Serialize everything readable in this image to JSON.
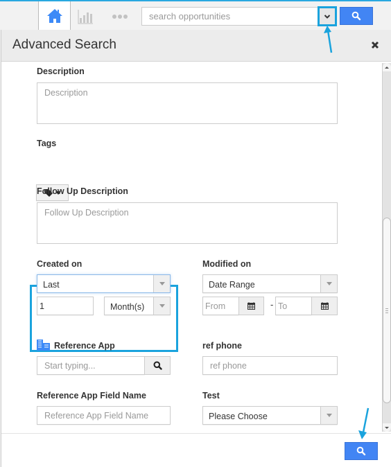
{
  "topbar": {
    "nav": [
      {
        "name": "home",
        "icon": "home-icon",
        "active": true
      },
      {
        "name": "reports",
        "icon": "bar-chart-icon",
        "active": false
      },
      {
        "name": "more",
        "icon": "more-dots-icon",
        "active": false
      }
    ],
    "search": {
      "placeholder": "search opportunities",
      "value": "",
      "dropdown_icon": "chevron-down-icon",
      "button_icon": "search-icon"
    }
  },
  "modal": {
    "title": "Advanced Search",
    "close_icon": "close-icon",
    "fields": {
      "description": {
        "label": "Description",
        "placeholder": "Description"
      },
      "tags": {
        "label": "Tags",
        "icon": "tag-icon"
      },
      "follow_up_description": {
        "label": "Follow Up Description",
        "placeholder": "Follow Up Description"
      },
      "created_on": {
        "label": "Created on",
        "mode": "Last",
        "amount": "1",
        "unit": "Month(s)"
      },
      "modified_on": {
        "label": "Modified on",
        "mode": "Date Range",
        "from_placeholder": "From",
        "to_placeholder": "To",
        "separator": "-"
      },
      "reference_app": {
        "label": "Reference App",
        "placeholder": "Start typing...",
        "icon": "building-icon"
      },
      "ref_phone": {
        "label": "ref phone",
        "placeholder": "ref phone"
      },
      "reference_app_field_name": {
        "label": "Reference App Field Name",
        "placeholder": "Reference App Field Name"
      },
      "test": {
        "label": "Test",
        "value": "Please Choose"
      }
    },
    "footer": {
      "search_icon": "search-icon"
    }
  },
  "colors": {
    "accent": "#4285f4",
    "highlight": "#1aa3dd",
    "home_icon": "#3d8af7"
  }
}
